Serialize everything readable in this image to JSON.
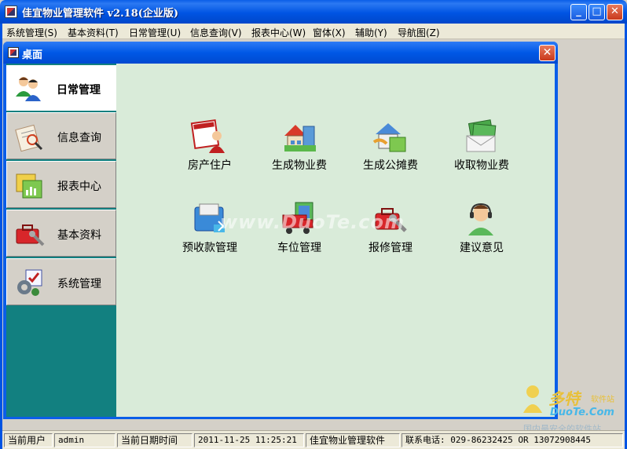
{
  "window": {
    "title": "佳宜物业管理软件  v2.18(企业版)",
    "minimize": "_",
    "maximize": "□",
    "close": "✕"
  },
  "menu": [
    "系统管理(S)",
    "基本资料(T)",
    "日常管理(U)",
    "信息查询(V)",
    "报表中心(W)",
    "窗体(X)",
    "辅助(Y)",
    "导航图(Z)"
  ],
  "child_window": {
    "title": "桌面",
    "close": "✕"
  },
  "nav": {
    "items": [
      {
        "label": "日常管理",
        "icon": "users-icon",
        "active": true
      },
      {
        "label": "信息查询",
        "icon": "document-search-icon",
        "active": false
      },
      {
        "label": "报表中心",
        "icon": "report-chart-icon",
        "active": false
      },
      {
        "label": "基本资料",
        "icon": "toolbox-icon",
        "active": false
      },
      {
        "label": "系统管理",
        "icon": "system-settings-icon",
        "active": false
      }
    ]
  },
  "tiles": [
    {
      "label": "房产住户",
      "icon": "calendar-person-icon"
    },
    {
      "label": "生成物业费",
      "icon": "house-building-icon"
    },
    {
      "label": "生成公摊费",
      "icon": "shared-fee-icon"
    },
    {
      "label": "收取物业费",
      "icon": "money-envelope-icon"
    },
    {
      "label": "预收款管理",
      "icon": "folders-icon"
    },
    {
      "label": "车位管理",
      "icon": "parking-truck-icon"
    },
    {
      "label": "报修管理",
      "icon": "repair-toolbox-icon"
    },
    {
      "label": "建议意见",
      "icon": "support-headset-icon"
    }
  ],
  "watermark": "www.DuoTe.com",
  "status": {
    "user_label": "当前用户",
    "user_value": "admin",
    "date_label": "当前日期时间",
    "date_value": "2011-11-25 11:25:21",
    "product": "佳宜物业管理软件",
    "contact": "联系电话: 029-86232425  OR  13072908445"
  },
  "site_logo": {
    "name": "多特",
    "tag": "软件站",
    "domain": "DuoTe.Com",
    "slogan": "国内最安全的软件站"
  },
  "colors": {
    "nav_bg": "#128080",
    "main_bg": "#d9ebd9",
    "title_blue": "#0054e3"
  }
}
